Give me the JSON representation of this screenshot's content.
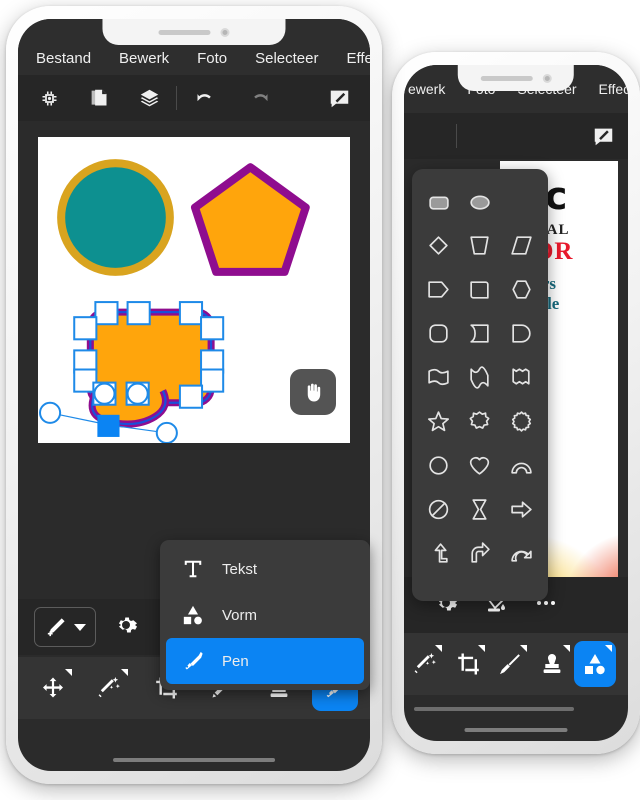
{
  "app": {
    "menu_items": [
      "Bestand",
      "Bewerk",
      "Foto",
      "Selecteer",
      "Effect"
    ],
    "toolbar_icons": [
      "chip-icon",
      "document-icon",
      "layers-icon",
      "undo-icon",
      "redo-icon",
      "comment-edit-icon"
    ]
  },
  "canvas": {
    "shapes": [
      {
        "name": "circle",
        "fill": "#0d9090",
        "stroke": "#d9a41f",
        "stroke_width": 7
      },
      {
        "name": "pentagon",
        "fill": "#ffa50c",
        "stroke": "#8f0d8f",
        "stroke_width": 7
      },
      {
        "name": "selected-rounded-shape",
        "fill": "#ffa50c",
        "stroke": "#8f0d8f",
        "stroke_width": 6
      }
    ],
    "selection": {
      "handle_fill": "#ffffff",
      "handle_stroke": "#1e8ae8",
      "active_point_fill": "#0b84f3",
      "handle_count": 13
    },
    "hand_tool": {
      "icon": "hand-icon",
      "label": "Hand"
    }
  },
  "context_menu": {
    "items": [
      {
        "label": "Tekst",
        "icon": "text-icon",
        "selected": false
      },
      {
        "label": "Vorm",
        "icon": "shapes-icon",
        "selected": false
      },
      {
        "label": "Pen",
        "icon": "pen-nib-icon",
        "selected": true
      }
    ],
    "accent": "#0b84f3"
  },
  "options_bar_a": {
    "pen_add": {
      "icon": "pen-add-icon",
      "caret": "chevron-down-icon"
    },
    "settings": {
      "icon": "gear-icon"
    }
  },
  "bottom_tools_a": [
    {
      "name": "move",
      "icon": "move-icon",
      "active": false
    },
    {
      "name": "magic-wand",
      "icon": "magic-wand-icon",
      "active": false
    },
    {
      "name": "crop",
      "icon": "crop-icon",
      "active": false
    },
    {
      "name": "pencil",
      "icon": "pencil-icon",
      "active": false
    },
    {
      "name": "stamp",
      "icon": "stamp-icon",
      "active": false
    },
    {
      "name": "pen",
      "icon": "pen-nib-icon",
      "active": true
    }
  ],
  "phone_b": {
    "menu_items": [
      "ewerk",
      "Foto",
      "Selecteer",
      "Effect"
    ],
    "shape_picker": {
      "rows": [
        [
          {
            "name": "rounded-rect-filled",
            "filled": true
          },
          {
            "name": "ellipse-filled",
            "filled": true
          },
          {
            "name": "blank",
            "filled": false
          }
        ],
        [
          {
            "name": "diamond",
            "filled": false
          },
          {
            "name": "trapezoid",
            "filled": false
          },
          {
            "name": "parallelogram",
            "filled": false
          }
        ],
        [
          {
            "name": "pennant",
            "filled": false
          },
          {
            "name": "square-soft",
            "filled": false
          },
          {
            "name": "hexagon",
            "filled": false
          }
        ],
        [
          {
            "name": "rounded-square",
            "filled": false
          },
          {
            "name": "half-round-left",
            "filled": false
          },
          {
            "name": "d-shape",
            "filled": false
          }
        ],
        [
          {
            "name": "flag-wave",
            "filled": false
          },
          {
            "name": "ribbon-wave",
            "filled": false
          },
          {
            "name": "torn-page",
            "filled": false
          }
        ],
        [
          {
            "name": "star",
            "filled": false
          },
          {
            "name": "burst-8",
            "filled": false
          },
          {
            "name": "burst-16",
            "filled": false
          }
        ],
        [
          {
            "name": "circle-ring",
            "filled": false
          },
          {
            "name": "heart",
            "filled": false
          },
          {
            "name": "arc",
            "filled": false
          }
        ],
        [
          {
            "name": "no-entry",
            "filled": false
          },
          {
            "name": "bowtie",
            "filled": false
          },
          {
            "name": "right-arrow",
            "filled": false
          }
        ],
        [
          {
            "name": "bent-arrow-up",
            "filled": false
          },
          {
            "name": "curved-arrow-right",
            "filled": false
          },
          {
            "name": "arc-arrow",
            "filled": false
          }
        ]
      ]
    },
    "photo_text": {
      "line1": "Pic",
      "line2": "SIONAL",
      "line3": "ITOR",
      "line4": "Layers",
      "line5": "SD File"
    },
    "options_bar": [
      {
        "name": "settings",
        "icon": "gear-icon"
      },
      {
        "name": "paint-bucket",
        "icon": "paint-bucket-icon"
      },
      {
        "name": "more",
        "icon": "more-dots-icon"
      }
    ],
    "bottom_tools": [
      {
        "name": "magic-wand",
        "icon": "magic-wand-icon",
        "active": false
      },
      {
        "name": "crop",
        "icon": "crop-icon",
        "active": false
      },
      {
        "name": "brush",
        "icon": "brush-icon",
        "active": false
      },
      {
        "name": "stamp",
        "icon": "stamp-icon",
        "active": false
      },
      {
        "name": "shapes",
        "icon": "shapes-icon",
        "active": true
      }
    ],
    "hand_tool": {
      "icon": "hand-icon"
    }
  },
  "colors": {
    "accent": "#0b84f3",
    "panel": "#3b3b3b",
    "bar": "#262626",
    "menubar": "#2e2e2e",
    "strip": "#343434",
    "screen_bg": "#2b2b2b"
  }
}
